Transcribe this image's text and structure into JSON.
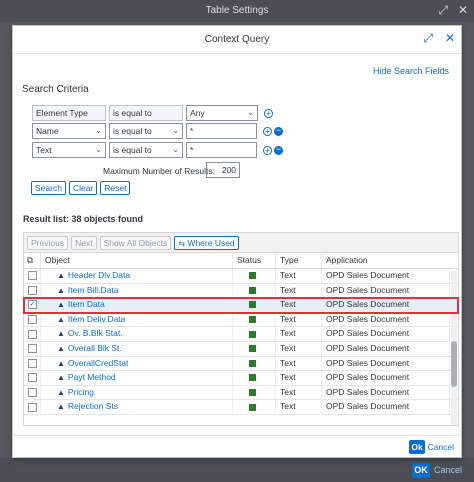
{
  "background_dialog": {
    "title": "Table Settings",
    "expand_icon": "expand-icon",
    "close_icon": "close-icon",
    "ok_label": "OK",
    "cancel_label": "Cancel"
  },
  "dialog": {
    "title": "Context Query",
    "hide_link": "Hide Search Fields",
    "search_criteria_label": "Search Criteria",
    "criteria": [
      {
        "element": "Element Type",
        "operator": "is equal to",
        "value": "Any"
      },
      {
        "element": "Name",
        "operator": "is equal to",
        "value": "*"
      },
      {
        "element": "Text",
        "operator": "is equal to",
        "value": "*"
      }
    ],
    "max_results_label": "Maximum Number of Results:",
    "max_results_value": "200",
    "buttons": {
      "search": "Search",
      "clear": "Clear",
      "reset": "Reset"
    },
    "result_label": "Result list: 38  objects found",
    "toolbar": {
      "previous": "Previous",
      "next": "Next",
      "show_all": "Show All Objects",
      "where_used": "Where Used"
    },
    "columns": {
      "object": "Object",
      "status": "Status",
      "type": "Type",
      "application": "Application"
    },
    "rows": [
      {
        "object": "Header Dlv.Data",
        "type": "Text",
        "application": "OPD Sales Document",
        "checked": false
      },
      {
        "object": "Item Bill.Data",
        "type": "Text",
        "application": "OPD Sales Document",
        "checked": false
      },
      {
        "object": "Item Data",
        "type": "Text",
        "application": "OPD Sales Document",
        "checked": true
      },
      {
        "object": "Item Deliv.Data",
        "type": "Text",
        "application": "OPD Sales Document",
        "checked": false
      },
      {
        "object": "Ov. B.Blk Stat.",
        "type": "Text",
        "application": "OPD Sales Document",
        "checked": false
      },
      {
        "object": "Overall Blk St.",
        "type": "Text",
        "application": "OPD Sales Document",
        "checked": false
      },
      {
        "object": "OverallCredStat",
        "type": "Text",
        "application": "OPD Sales Document",
        "checked": false
      },
      {
        "object": "Payt Method",
        "type": "Text",
        "application": "OPD Sales Document",
        "checked": false
      },
      {
        "object": "Pricing",
        "type": "Text",
        "application": "OPD Sales Document",
        "checked": false
      },
      {
        "object": "Rejection Sts",
        "type": "Text",
        "application": "OPD Sales Document",
        "checked": false
      }
    ],
    "footer": {
      "ok": "Ok",
      "cancel": "Cancel"
    }
  },
  "colors": {
    "accent": "#0a6ed1",
    "status_ok": "#2b7d2b",
    "highlight": "#e0303a"
  }
}
